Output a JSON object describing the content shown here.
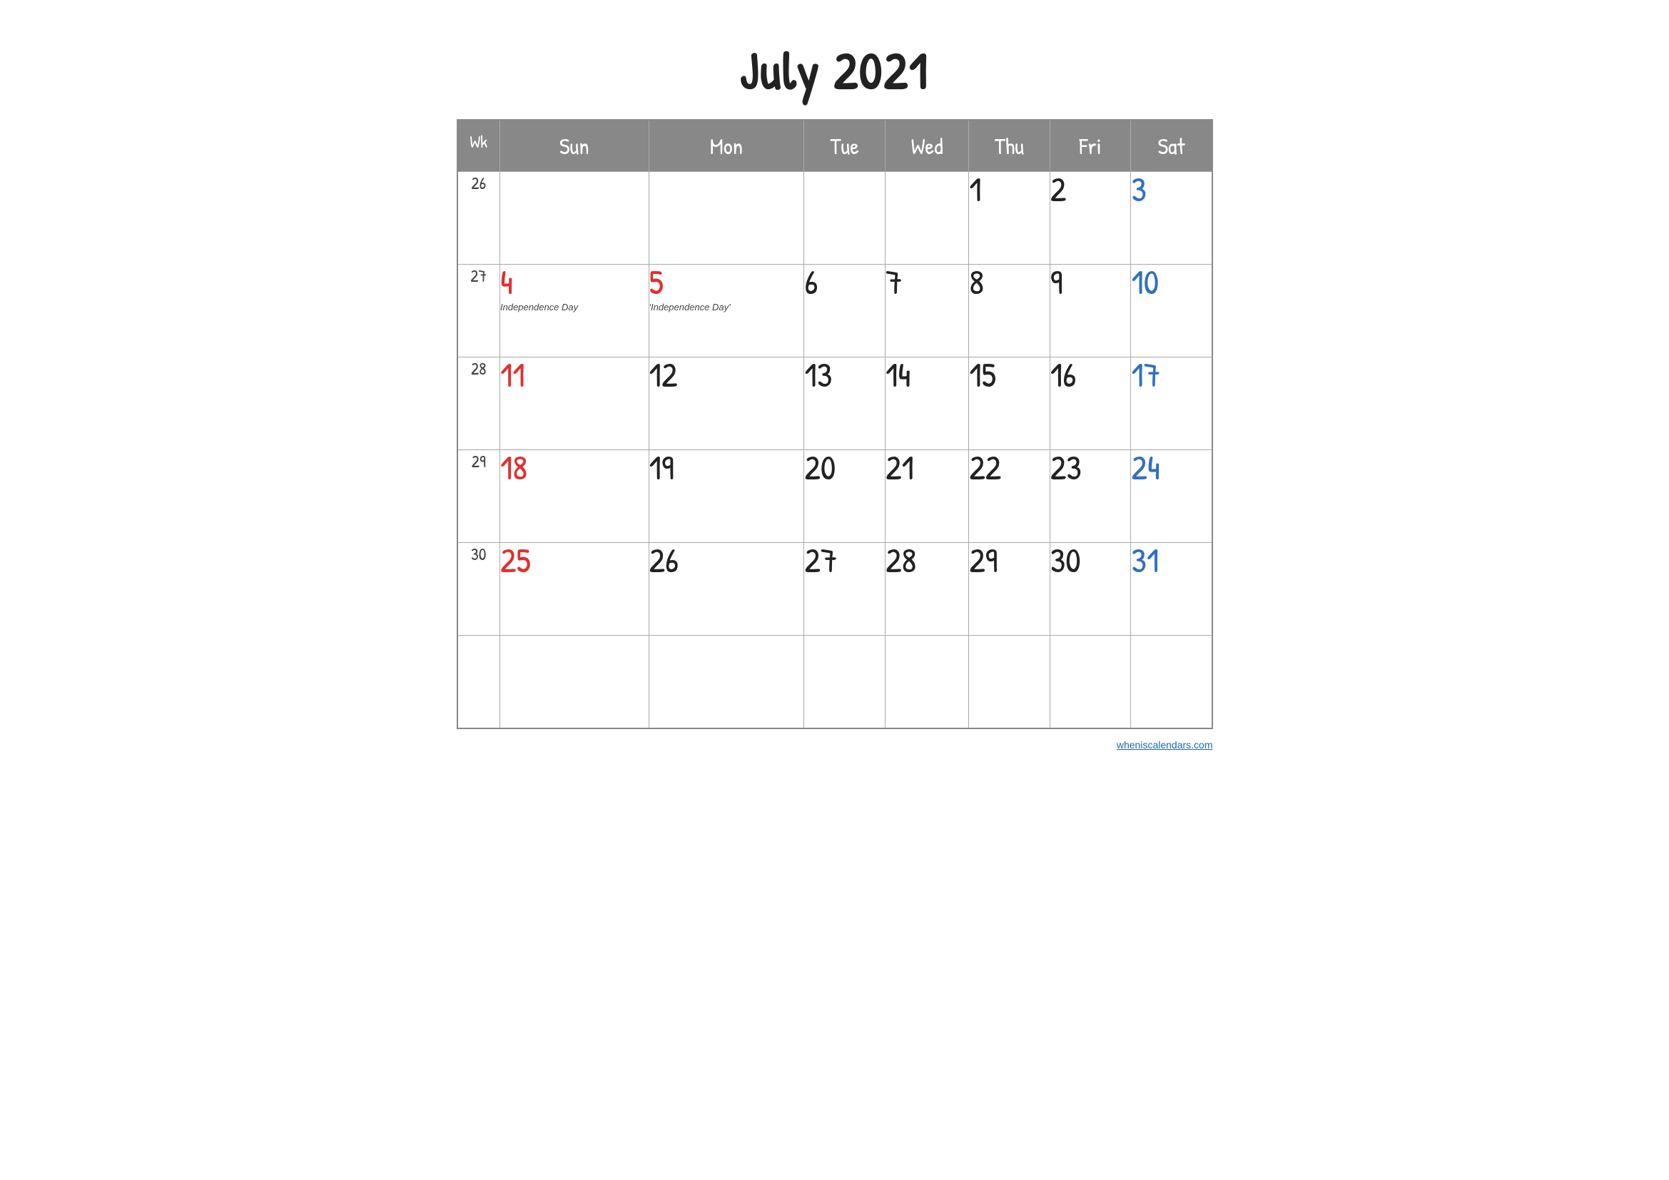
{
  "title": "July 2021",
  "watermark": {
    "text": "wheniscalendars.com",
    "url": "#"
  },
  "headers": {
    "wk": "Wk",
    "days": [
      "Sun",
      "Mon",
      "Tue",
      "Wed",
      "Thu",
      "Fri",
      "Sat"
    ]
  },
  "weeks": [
    {
      "wk": "26",
      "days": [
        {
          "num": "",
          "color": "black",
          "holiday": ""
        },
        {
          "num": "",
          "color": "black",
          "holiday": ""
        },
        {
          "num": "",
          "color": "black",
          "holiday": ""
        },
        {
          "num": "",
          "color": "black",
          "holiday": ""
        },
        {
          "num": "1",
          "color": "black",
          "holiday": ""
        },
        {
          "num": "2",
          "color": "black",
          "holiday": ""
        },
        {
          "num": "3",
          "color": "blue",
          "holiday": ""
        }
      ]
    },
    {
      "wk": "27",
      "days": [
        {
          "num": "4",
          "color": "red",
          "holiday": "Independence Day"
        },
        {
          "num": "5",
          "color": "red",
          "holiday": "'Independence Day'"
        },
        {
          "num": "6",
          "color": "black",
          "holiday": ""
        },
        {
          "num": "7",
          "color": "black",
          "holiday": ""
        },
        {
          "num": "8",
          "color": "black",
          "holiday": ""
        },
        {
          "num": "9",
          "color": "black",
          "holiday": ""
        },
        {
          "num": "10",
          "color": "blue",
          "holiday": ""
        }
      ]
    },
    {
      "wk": "28",
      "days": [
        {
          "num": "11",
          "color": "red",
          "holiday": ""
        },
        {
          "num": "12",
          "color": "black",
          "holiday": ""
        },
        {
          "num": "13",
          "color": "black",
          "holiday": ""
        },
        {
          "num": "14",
          "color": "black",
          "holiday": ""
        },
        {
          "num": "15",
          "color": "black",
          "holiday": ""
        },
        {
          "num": "16",
          "color": "black",
          "holiday": ""
        },
        {
          "num": "17",
          "color": "blue",
          "holiday": ""
        }
      ]
    },
    {
      "wk": "29",
      "days": [
        {
          "num": "18",
          "color": "red",
          "holiday": ""
        },
        {
          "num": "19",
          "color": "black",
          "holiday": ""
        },
        {
          "num": "20",
          "color": "black",
          "holiday": ""
        },
        {
          "num": "21",
          "color": "black",
          "holiday": ""
        },
        {
          "num": "22",
          "color": "black",
          "holiday": ""
        },
        {
          "num": "23",
          "color": "black",
          "holiday": ""
        },
        {
          "num": "24",
          "color": "blue",
          "holiday": ""
        }
      ]
    },
    {
      "wk": "30",
      "days": [
        {
          "num": "25",
          "color": "red",
          "holiday": ""
        },
        {
          "num": "26",
          "color": "black",
          "holiday": ""
        },
        {
          "num": "27",
          "color": "black",
          "holiday": ""
        },
        {
          "num": "28",
          "color": "black",
          "holiday": ""
        },
        {
          "num": "29",
          "color": "black",
          "holiday": ""
        },
        {
          "num": "30",
          "color": "black",
          "holiday": ""
        },
        {
          "num": "31",
          "color": "blue",
          "holiday": ""
        }
      ]
    },
    {
      "wk": "",
      "days": [
        {
          "num": "",
          "color": "black",
          "holiday": ""
        },
        {
          "num": "",
          "color": "black",
          "holiday": ""
        },
        {
          "num": "",
          "color": "black",
          "holiday": ""
        },
        {
          "num": "",
          "color": "black",
          "holiday": ""
        },
        {
          "num": "",
          "color": "black",
          "holiday": ""
        },
        {
          "num": "",
          "color": "black",
          "holiday": ""
        },
        {
          "num": "",
          "color": "black",
          "holiday": ""
        }
      ]
    }
  ]
}
